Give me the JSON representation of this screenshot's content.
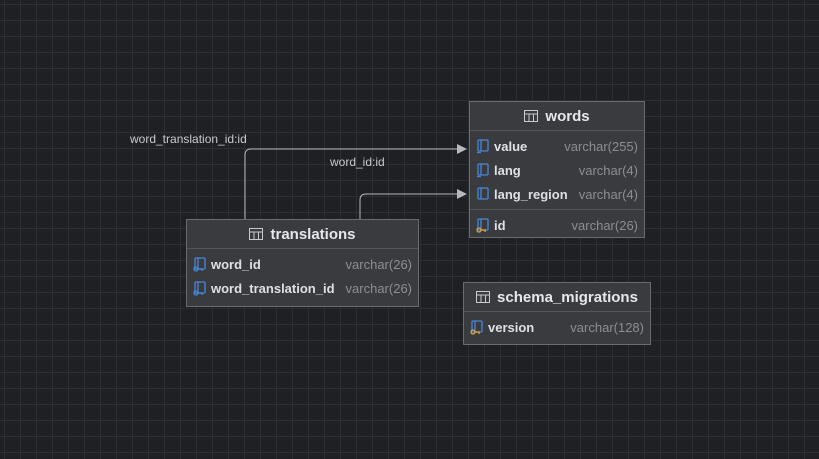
{
  "edges": [
    {
      "label": "word_translation_id:id"
    },
    {
      "label": "word_id:id"
    }
  ],
  "tables": {
    "words": {
      "name": "words",
      "columns": [
        {
          "name": "value",
          "type": "varchar(255)",
          "icon": "column-icon"
        },
        {
          "name": "lang",
          "type": "varchar(4)",
          "icon": "column-icon"
        },
        {
          "name": "lang_region",
          "type": "varchar(4)",
          "icon": "column-icon"
        }
      ],
      "keys": [
        {
          "name": "id",
          "type": "varchar(26)",
          "icon": "primary-key-column-icon"
        }
      ]
    },
    "translations": {
      "name": "translations",
      "columns": [
        {
          "name": "word_id",
          "type": "varchar(26)",
          "icon": "foreign-key-column-icon"
        },
        {
          "name": "word_translation_id",
          "type": "varchar(26)",
          "icon": "foreign-key-column-icon"
        }
      ]
    },
    "schema_migrations": {
      "name": "schema_migrations",
      "columns": [
        {
          "name": "version",
          "type": "varchar(128)",
          "icon": "primary-key-column-icon"
        }
      ]
    }
  },
  "colors": {
    "background": "#1f2023",
    "table_fill": "#3a3b3e",
    "table_border": "#6a6b6f",
    "edge": "#b8b9bc",
    "icon_blue": "#4a86d8",
    "icon_gold": "#d9a441"
  }
}
